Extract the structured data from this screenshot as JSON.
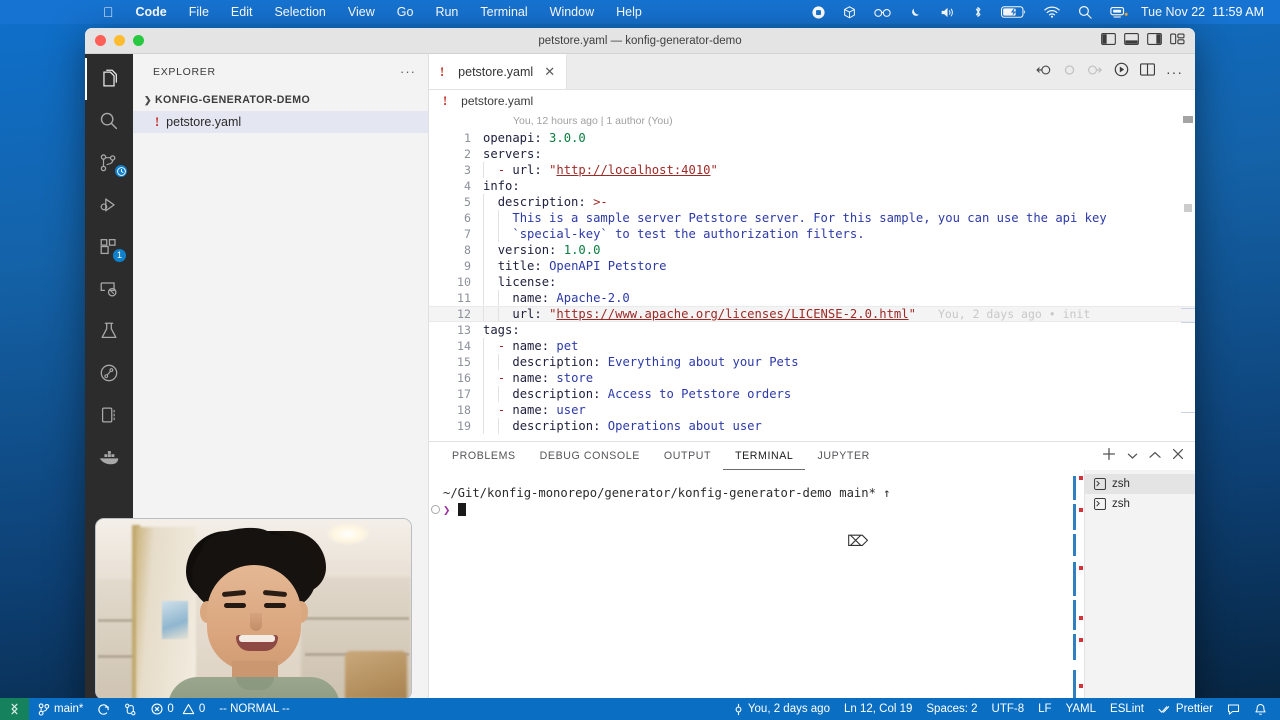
{
  "menubar": {
    "apple": "apple-logo",
    "items": [
      {
        "label": "Code",
        "bold": true
      },
      {
        "label": "File",
        "bold": false
      },
      {
        "label": "Edit",
        "bold": false
      },
      {
        "label": "Selection",
        "bold": false
      },
      {
        "label": "View",
        "bold": false
      },
      {
        "label": "Go",
        "bold": false
      },
      {
        "label": "Run",
        "bold": false
      },
      {
        "label": "Terminal",
        "bold": false
      },
      {
        "label": "Window",
        "bold": false
      },
      {
        "label": "Help",
        "bold": false
      }
    ],
    "status_icons": [
      "record-stop-icon",
      "box-icon",
      "glasses-icon",
      "moon-icon",
      "volume-icon",
      "bluetooth-icon",
      "battery-charging-icon",
      "wifi-icon",
      "search-icon",
      "control-center-icon"
    ],
    "date": "Tue Nov 22",
    "time": "11:59 AM"
  },
  "window": {
    "title": "petstore.yaml — konfig-generator-demo",
    "traffic_lights": [
      "close",
      "minimize",
      "zoom"
    ],
    "layout_icons": [
      "toggle-primary-sidebar-icon",
      "toggle-panel-icon",
      "toggle-secondary-sidebar-icon",
      "customize-layout-icon"
    ]
  },
  "activitybar": {
    "items": [
      {
        "name": "explorer",
        "icon": "files-icon",
        "active": true,
        "badge": null
      },
      {
        "name": "search",
        "icon": "search-icon",
        "active": false,
        "badge": null
      },
      {
        "name": "source-control",
        "icon": "source-control-icon",
        "active": false,
        "badge": null
      },
      {
        "name": "run-and-debug",
        "icon": "run-debug-icon",
        "active": false,
        "badge": null
      },
      {
        "name": "extensions",
        "icon": "extensions-icon",
        "active": false,
        "badge": "1"
      },
      {
        "name": "remote-explorer",
        "icon": "remote-explorer-icon",
        "active": false,
        "badge": null
      },
      {
        "name": "testing",
        "icon": "beaker-icon",
        "active": false,
        "badge": null
      },
      {
        "name": "graph",
        "icon": "circle-graph-icon",
        "active": false,
        "badge": null
      },
      {
        "name": "database",
        "icon": "database-icon",
        "active": false,
        "badge": null
      },
      {
        "name": "docker",
        "icon": "docker-whale-icon",
        "active": false,
        "badge": null
      }
    ]
  },
  "sidebar": {
    "header": "EXPLORER",
    "more_actions": "···",
    "folder": "KONFIG-GENERATOR-DEMO",
    "files": [
      {
        "name": "petstore.yaml",
        "mark": "!",
        "selected": true
      }
    ]
  },
  "editor": {
    "tab": {
      "label": "petstore.yaml",
      "mark": "!",
      "close": "✕"
    },
    "actions": [
      "timeline-back-icon",
      "timeline-current-icon",
      "timeline-forward-icon",
      "run-code-icon",
      "split-editor-icon",
      "more-actions-icon"
    ],
    "breadcrumb": {
      "mark": "!",
      "label": "petstore.yaml"
    },
    "blame_header": "You, 12 hours ago | 1 author (You)",
    "inline_blame": {
      "line": 12,
      "text": "You, 2 days ago • init"
    },
    "lines": [
      {
        "n": "1",
        "indent": 0,
        "html": "<span class=\"k\">openapi:</span> <span class=\"num\">3.0.0</span>"
      },
      {
        "n": "2",
        "indent": 0,
        "html": "<span class=\"k\">servers:</span>"
      },
      {
        "n": "3",
        "indent": 1,
        "html": "  <span class=\"op\">-</span> <span class=\"k\">url:</span> <span class=\"str\">\"</span><span class=\"lnk\">http://localhost:4010</span><span class=\"str\">\"</span>"
      },
      {
        "n": "4",
        "indent": 0,
        "html": "<span class=\"k\">info:</span>"
      },
      {
        "n": "5",
        "indent": 1,
        "html": "  <span class=\"k\">description:</span> <span class=\"op\">&gt;-</span>"
      },
      {
        "n": "6",
        "indent": 2,
        "html": "    <span class=\"val\">This is a sample server Petstore server. For this sample, you can use the api key</span>"
      },
      {
        "n": "7",
        "indent": 2,
        "html": "    <span class=\"val\">`special-key` to test the authorization filters.</span>"
      },
      {
        "n": "8",
        "indent": 1,
        "html": "  <span class=\"k\">version:</span> <span class=\"num\">1.0.0</span>"
      },
      {
        "n": "9",
        "indent": 1,
        "html": "  <span class=\"k\">title:</span> <span class=\"val\">OpenAPI Petstore</span>"
      },
      {
        "n": "10",
        "indent": 1,
        "html": "  <span class=\"k\">license:</span>"
      },
      {
        "n": "11",
        "indent": 2,
        "html": "    <span class=\"k\">name:</span> <span class=\"val\">Apache-2.0</span>"
      },
      {
        "n": "12",
        "indent": 2,
        "html": "    <span class=\"k\">url:</span> <span class=\"str\">\"</span><span class=\"lnk\">https://www.apache.org/licenses/LICENSE-2.0.html</span><span class=\"str\">\"</span>",
        "highlight": true
      },
      {
        "n": "13",
        "indent": 0,
        "html": "<span class=\"k\">tags:</span>"
      },
      {
        "n": "14",
        "indent": 1,
        "html": "  <span class=\"op\">-</span> <span class=\"k\">name:</span> <span class=\"val\">pet</span>"
      },
      {
        "n": "15",
        "indent": 2,
        "html": "    <span class=\"k\">description:</span> <span class=\"val\">Everything about your Pets</span>"
      },
      {
        "n": "16",
        "indent": 1,
        "html": "  <span class=\"op\">-</span> <span class=\"k\">name:</span> <span class=\"val\">store</span>"
      },
      {
        "n": "17",
        "indent": 2,
        "html": "    <span class=\"k\">description:</span> <span class=\"val\">Access to Petstore orders</span>"
      },
      {
        "n": "18",
        "indent": 1,
        "html": "  <span class=\"op\">-</span> <span class=\"k\">name:</span> <span class=\"val\">user</span>"
      },
      {
        "n": "19",
        "indent": 2,
        "html": "    <span class=\"k\">description:</span> <span class=\"val\">Operations about user</span>"
      }
    ]
  },
  "panel": {
    "tabs": [
      {
        "label": "PROBLEMS",
        "active": false
      },
      {
        "label": "DEBUG CONSOLE",
        "active": false
      },
      {
        "label": "OUTPUT",
        "active": false
      },
      {
        "label": "TERMINAL",
        "active": true
      },
      {
        "label": "JUPYTER",
        "active": false
      }
    ],
    "actions": [
      "new-terminal-icon",
      "terminal-dropdown-icon",
      "maximize-panel-icon",
      "close-panel-icon"
    ],
    "terminal": {
      "path": "~/Git/konfig-monorepo/generator/konfig-generator-demo",
      "branch": "main*",
      "branch_arrow": "↑",
      "prompt": "❯",
      "input": ""
    },
    "terminal_list": [
      {
        "label": "zsh",
        "icon": "terminal-icon",
        "selected": true
      },
      {
        "label": "zsh",
        "icon": "terminal-icon",
        "selected": false
      }
    ]
  },
  "statusbar": {
    "remote_icon": "remote-window-icon",
    "branch": "main*",
    "sync_icon": "sync-icon",
    "branch_compare_icon": "git-compare-icon",
    "errors": "0",
    "warnings": "0",
    "mode": "-- NORMAL --",
    "right": {
      "blame": "You, 2 days ago",
      "position": "Ln 12, Col 19",
      "spaces": "Spaces: 2",
      "encoding": "UTF-8",
      "eol": "LF",
      "language": "YAML",
      "eslint": "ESLint",
      "prettier": "Prettier",
      "feedback_icon": "feedback-icon",
      "bell_icon": "bell-icon"
    }
  },
  "webcam": {
    "label": "webcam-overlay"
  },
  "colors": {
    "menubar_blue": "#1673d1",
    "statusbar_blue": "#0a6fc2",
    "remote_green": "#16825d",
    "accent_blue": "#0f80cc",
    "yaml_string": "#9c2a27",
    "yaml_number": "#0a7c3e",
    "yaml_value": "#2c3aa8"
  }
}
